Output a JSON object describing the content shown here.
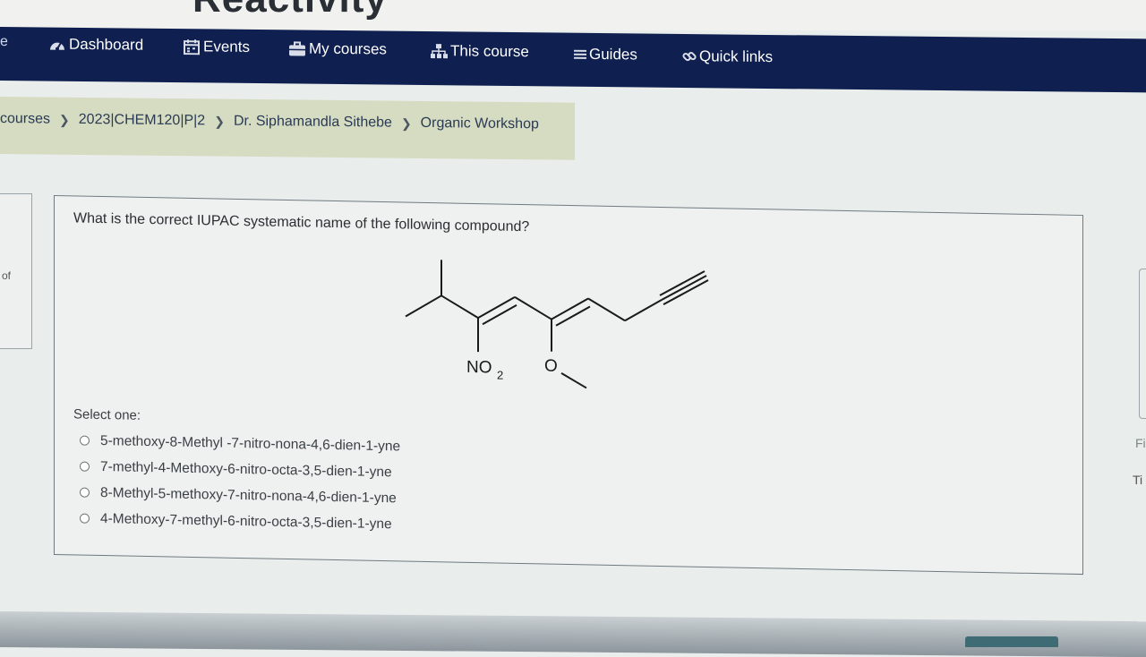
{
  "site": {
    "title_fragment": "Reactivity"
  },
  "navbar": {
    "edge_text": "e",
    "items": [
      {
        "label": "Dashboard",
        "icon": "dashboard-icon"
      },
      {
        "label": "Events",
        "icon": "calendar-icon"
      },
      {
        "label": "My courses",
        "icon": "briefcase-icon"
      },
      {
        "label": "This course",
        "icon": "sitemap-icon"
      },
      {
        "label": "Guides",
        "icon": "list-icon"
      },
      {
        "label": "Quick links",
        "icon": "link-icon"
      }
    ]
  },
  "breadcrumb": {
    "items": [
      "courses",
      "2023|CHEM120|P|2",
      "Dr. Siphamandla Sithebe",
      "Organic Workshop"
    ]
  },
  "left_panel": {
    "text": "of"
  },
  "question": {
    "text": "What is the correct IUPAC systematic name of the following compound?",
    "structure_labels": {
      "nitro": "NO",
      "nitro_subscript": "2",
      "oxygen": "O"
    },
    "select_label": "Select one:",
    "options": [
      "5-methoxy-8-Methyl -7-nitro-nona-4,6-dien-1-yne",
      "7-methyl-4-Methoxy-6-nitro-octa-3,5-dien-1-yne",
      "8-Methyl-5-methoxy-7-nitro-nona-4,6-dien-1-yne",
      "4-Methoxy-7-methyl-6-nitro-octa-3,5-dien-1-yne"
    ]
  },
  "right_edge": {
    "text1": "Fi",
    "text2": "Ti"
  },
  "colors": {
    "navbar": "#0f1f4f",
    "breadcrumb_bg": "#d6dcc1",
    "page_bg": "#e9edec"
  }
}
